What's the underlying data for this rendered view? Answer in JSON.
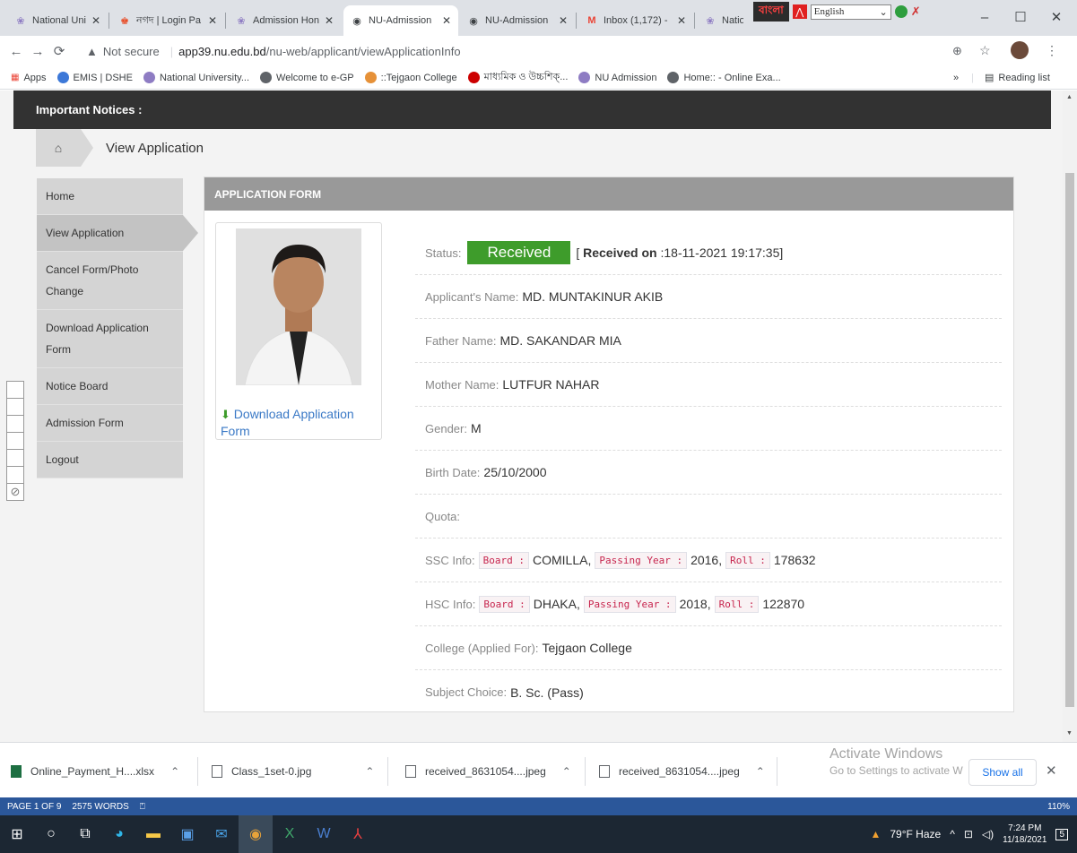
{
  "browser": {
    "tabs": [
      {
        "title": "National Unive",
        "icon": "nu-favicon"
      },
      {
        "title": "নগদ | Login Pa",
        "icon": "nagad-favicon"
      },
      {
        "title": "Admission Hon",
        "icon": "nu-favicon"
      },
      {
        "title": "NU-Admission",
        "icon": "globe-favicon",
        "active": true
      },
      {
        "title": "NU-Admission",
        "icon": "globe-favicon"
      },
      {
        "title": "Inbox (1,172) -",
        "icon": "gmail-favicon"
      },
      {
        "title": "National Unive",
        "icon": "nu-favicon"
      }
    ],
    "ime_bangla": "বাংলা",
    "ime_language": "English",
    "security_label": "Not secure",
    "url_host": "app39.nu.edu.bd",
    "url_path": "/nu-web/applicant/viewApplicationInfo",
    "bookmarks": [
      {
        "label": "Apps",
        "color": "#ea4335"
      },
      {
        "label": "EMIS | DSHE",
        "color": "#3c78d8"
      },
      {
        "label": "National University...",
        "color": "#8e7cc3"
      },
      {
        "label": "Welcome to e-GP",
        "color": "#5f6368"
      },
      {
        "label": "::Tejgaon College",
        "color": "#e69138"
      },
      {
        "label": "মাধ্যমিক ও উচ্চশিক্...",
        "color": "#cc0000"
      },
      {
        "label": "NU Admission",
        "color": "#8e7cc3"
      },
      {
        "label": "Home:: - Online Exa...",
        "color": "#5f6368"
      }
    ],
    "more_bookmarks": "»",
    "reading_list": "Reading list"
  },
  "page": {
    "notices_title": "Important Notices :",
    "breadcrumb_current": "View Application",
    "sidebar": [
      {
        "label": "Home"
      },
      {
        "label": "View Application",
        "active": true
      },
      {
        "label": "Cancel Form/Photo Change"
      },
      {
        "label": "Download Application Form"
      },
      {
        "label": "Notice Board"
      },
      {
        "label": "Admission Form"
      },
      {
        "label": "Logout"
      }
    ],
    "panel_title": "APPLICATION FORM",
    "download_link": "Download Application Form",
    "status_label": "Status:",
    "status_value": "Received",
    "received_prefix": "[ ",
    "received_bold": "Received on",
    "received_date": " :18-11-2021 19:17:35]",
    "applicant_label": "Applicant's Name:",
    "applicant_value": "MD. MUNTAKINUR AKIB",
    "father_label": "Father Name:",
    "father_value": "MD. SAKANDAR MIA",
    "mother_label": "Mother Name:",
    "mother_value": "LUTFUR NAHAR",
    "gender_label": "Gender:",
    "gender_value": "M",
    "birth_label": "Birth Date:",
    "birth_value": "25/10/2000",
    "quota_label": "Quota:",
    "ssc_label": "SSC Info:",
    "ssc_board_tag": "Board :",
    "ssc_board": "COMILLA,",
    "ssc_year_tag": "Passing Year :",
    "ssc_year": "2016,",
    "ssc_roll_tag": "Roll :",
    "ssc_roll": "178632",
    "hsc_label": "HSC Info:",
    "hsc_board_tag": "Board :",
    "hsc_board": "DHAKA,",
    "hsc_year_tag": "Passing Year :",
    "hsc_year": "2018,",
    "hsc_roll_tag": "Roll :",
    "hsc_roll": "122870",
    "college_label": "College (Applied For):",
    "college_value": "Tejgaon College",
    "subject_label": "Subject Choice:",
    "subject_value": "B. Sc. (Pass)"
  },
  "downloads": {
    "items": [
      "Online_Payment_H....xlsx",
      "Class_1set-0.jpg",
      "received_8631054....jpeg",
      "received_8631054....jpeg"
    ],
    "show_all": "Show all",
    "activate_title": "Activate Windows",
    "activate_sub": "Go to Settings to activate W"
  },
  "word_status": {
    "page": "PAGE 1 OF 9",
    "words": "2575 WORDS",
    "zoom": "110%"
  },
  "taskbar": {
    "weather": "79°F Haze",
    "time": "7:24 PM",
    "date": "11/18/2021",
    "notifications": "5"
  }
}
